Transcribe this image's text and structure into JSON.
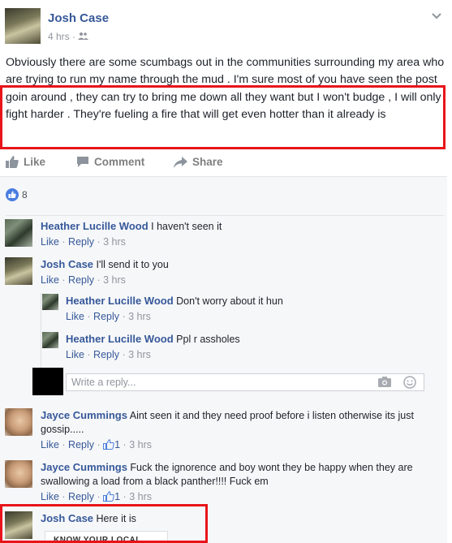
{
  "post": {
    "author": "Josh Case",
    "time": "4 hrs",
    "text": "Obviously there are some scumbags out in the communities surrounding my area who are trying to run my name through the mud . I'm sure most of you have seen the post goin around , they can try to bring me down all they want but I won't budge , I will only fight harder . They're fueling a fire that will get even hotter than it already is"
  },
  "actions": {
    "like": "Like",
    "comment": "Comment",
    "share": "Share"
  },
  "likes": {
    "count": "8"
  },
  "comments": [
    {
      "name": "Heather Lucille Wood",
      "text": "I haven't seen it",
      "like": "Like",
      "reply": "Reply",
      "time": "3 hrs"
    },
    {
      "name": "Josh Case",
      "text": "I'll send it to you",
      "like": "Like",
      "reply": "Reply",
      "time": "3 hrs"
    },
    {
      "name": "Heather Lucille Wood",
      "text": "Don't worry about it hun",
      "like": "Like",
      "reply": "Reply",
      "time": "3 hrs"
    },
    {
      "name": "Heather Lucille Wood",
      "text": "Ppl r assholes",
      "like": "Like",
      "reply": "Reply",
      "time": "3 hrs"
    },
    {
      "name": "Jayce Cummings",
      "text": "Aint seen it and they need proof before i listen otherwise its just gossip.....",
      "like": "Like",
      "reply": "Reply",
      "likes": "1",
      "time": "3 hrs"
    },
    {
      "name": "Jayce Cummings",
      "text": "Fuck the ignorence and boy wont they be happy when they are swallowing a load from a black panther!!!! Fuck em",
      "like": "Like",
      "reply": "Reply",
      "likes": "1",
      "time": "3 hrs"
    },
    {
      "name": "Josh Case",
      "text": "Here it is"
    }
  ],
  "reply_box": {
    "placeholder": "Write a reply..."
  },
  "attachment_preview": "KNOW YOUR LOCAL",
  "colors": {
    "link": "#365899",
    "highlight": "#e8141a",
    "muted": "#90949c"
  }
}
